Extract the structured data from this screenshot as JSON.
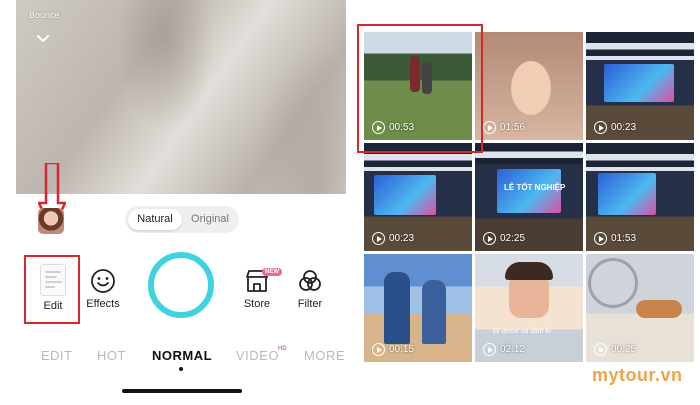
{
  "camera": {
    "preview_title": "Bounce",
    "style_options": [
      "Natural",
      "Original"
    ],
    "tools": {
      "edit_label": "Edit",
      "effects_label": "Effects",
      "store_label": "Store",
      "store_badge": "NEW",
      "filter_label": "Filter"
    },
    "modes": [
      "EDIT",
      "HOT",
      "NORMAL",
      "VIDEO",
      "MORE"
    ],
    "active_mode": "NORMAL",
    "video_badge": "HD",
    "accent_color": "#3fd3df",
    "highlight_color": "#d7262e"
  },
  "gallery": {
    "items": [
      {
        "duration": "00:53",
        "scene": "field"
      },
      {
        "duration": "01:56",
        "scene": "face"
      },
      {
        "duration": "00:23",
        "scene": "hall"
      },
      {
        "duration": "00:23",
        "scene": "hall"
      },
      {
        "duration": "02:25",
        "scene": "stage"
      },
      {
        "duration": "01:53",
        "scene": "hall"
      },
      {
        "duration": "00:15",
        "scene": "anime"
      },
      {
        "duration": "02:12",
        "scene": "selfie"
      },
      {
        "duration": "00:25",
        "scene": "cat"
      }
    ],
    "stage_banner": "LỄ TỐT NGHIỆP",
    "selfie_caption": "Đi detox dạ dịnh kì"
  },
  "watermark": "mytour.vn"
}
